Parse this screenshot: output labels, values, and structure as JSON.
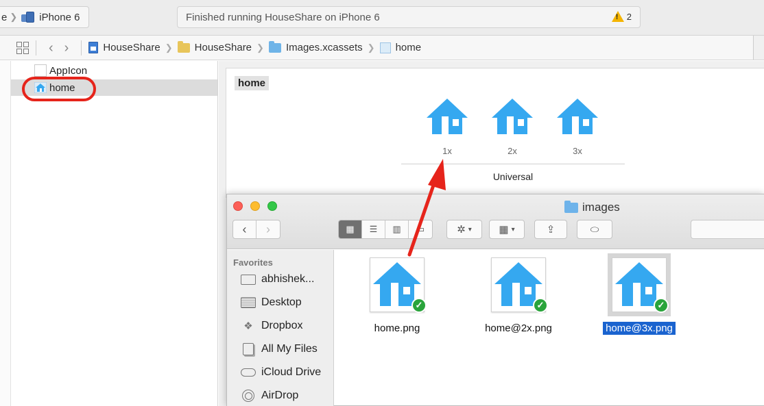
{
  "toolbar": {
    "scheme_prefix": "e",
    "device": "iPhone 6",
    "status": "Finished running HouseShare on iPhone 6",
    "warning_count": "2",
    "warning_color": "#f4b400"
  },
  "jumpbar": {
    "crumbs": [
      "HouseShare",
      "HouseShare",
      "Images.xcassets",
      "home"
    ]
  },
  "assets": {
    "items": [
      "AppIcon",
      "home"
    ],
    "selected": "home",
    "highlight_color": "#e6241b"
  },
  "editor": {
    "label": "home",
    "slots": [
      "1x",
      "2x",
      "3x"
    ],
    "device_group": "Universal",
    "icon_color": "#35a8f0"
  },
  "finder": {
    "title": "images",
    "favorites_header": "Favorites",
    "favorites": [
      "abhishek...",
      "Desktop",
      "Dropbox",
      "All My Files",
      "iCloud Drive",
      "AirDrop"
    ],
    "files": [
      "home.png",
      "home@2x.png",
      "home@3x.png"
    ],
    "selected_file": "home@3x.png",
    "selection_color": "#1a63cf"
  },
  "annotation": {
    "arrow_color": "#e6241b"
  }
}
